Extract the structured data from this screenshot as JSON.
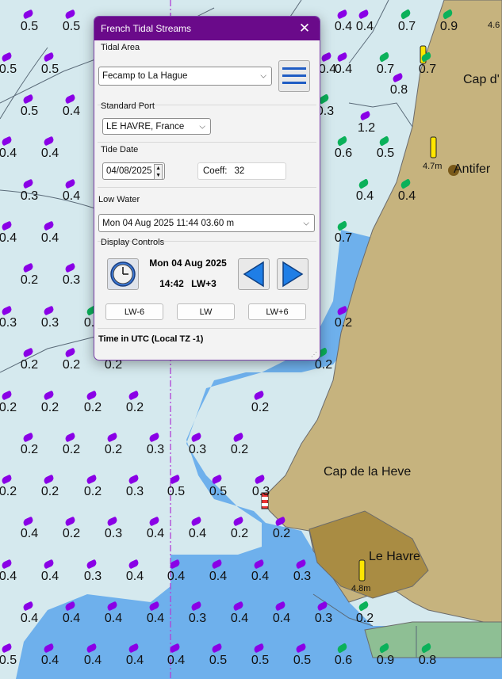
{
  "dialog": {
    "title": "French Tidal Streams",
    "close_glyph": "✕",
    "tidal_area_label": "Tidal Area",
    "tidal_area_value": "Fecamp to La Hague",
    "menu_icon": "hamburger-menu-icon",
    "standard_port_label": "Standard Port",
    "standard_port_value": "LE HAVRE, France",
    "tide_date_label": "Tide Date",
    "tide_date_value": "04/08/2025",
    "coeff_label": "Coeff:",
    "coeff_value": "32",
    "low_water_label": "Low Water",
    "low_water_value": "Mon 04 Aug 2025  11:44  03.60 m",
    "display_controls_label": "Display Controls",
    "display_date": "Mon 04 Aug 2025",
    "display_time": "14:42",
    "display_offset": "LW+3",
    "clock_icon": "clock-icon",
    "prev_icon": "triangle-left-icon",
    "next_icon": "triangle-right-icon",
    "btn_lw_minus": "LW-6",
    "btn_lw": "LW",
    "btn_lw_plus": "LW+6",
    "time_note": "Time in UTC  (Local TZ -1)"
  },
  "map": {
    "places": [
      "Cap d'",
      "Antifer",
      "Cap de la Heve",
      "Le Havre"
    ],
    "depths": [
      "4.6",
      "4.7m",
      "4.8m"
    ],
    "colors": {
      "sea": "#d5e9ee",
      "shallow": "#6eb0ec",
      "land": "#c6b37e",
      "drying": "#a98c43",
      "green_area": "#8ebf94",
      "purple_arrow": "#8a00e6",
      "green_arrow": "#0bb15a",
      "channel_line": "#b23fd6"
    },
    "stream_labels": [
      "0.5",
      "0.5",
      "0.4",
      "0.4",
      "0.7",
      "0.9",
      "0.5",
      "0.5",
      "0.4",
      "0.4",
      "0.7",
      "0.7",
      "0.8",
      "0.5",
      "0.4",
      "0.3",
      "1.2",
      "0.4",
      "0.4",
      "0.6",
      "0.5",
      "0.3",
      "0.4",
      "0.4",
      "0.4",
      "0.4",
      "0.4",
      "0.7",
      "0.2",
      "0.3",
      "0.4",
      "0.3",
      "0.3",
      "0.2",
      "0.2",
      "0.2",
      "0.2",
      "0.2",
      "0.2",
      "0.2",
      "0.2",
      "0.2",
      "0.2",
      "0.2",
      "0.2",
      "0.2",
      "0.2",
      "0.3",
      "0.3",
      "0.2",
      "0.2",
      "0.2",
      "0.2",
      "0.3",
      "0.5",
      "0.5",
      "0.3",
      "0.4",
      "0.2",
      "0.3",
      "0.4",
      "0.4",
      "0.2",
      "0.2",
      "0.4",
      "0.4",
      "0.3",
      "0.4",
      "0.4",
      "0.4",
      "0.4",
      "0.3",
      "0.4",
      "0.4",
      "0.4",
      "0.4",
      "0.3",
      "0.4",
      "0.4",
      "0.3",
      "0.2",
      "0.5",
      "0.4",
      "0.4",
      "0.4",
      "0.4",
      "0.5",
      "0.5",
      "0.5",
      "0.6",
      "0.9",
      "0.8"
    ]
  }
}
